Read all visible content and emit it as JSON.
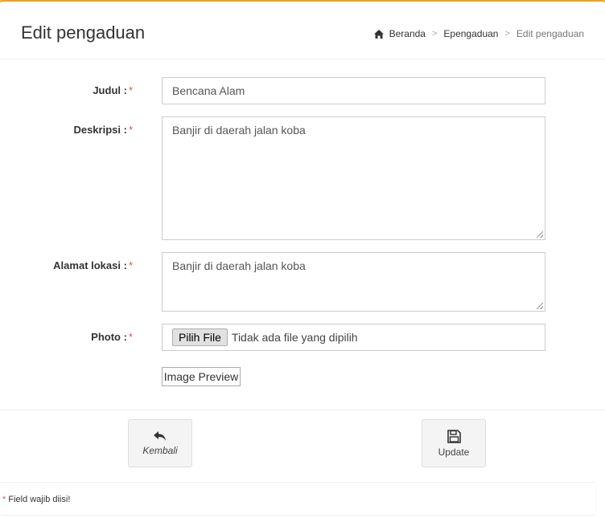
{
  "header": {
    "title": "Edit pengaduan",
    "breadcrumb": [
      {
        "label": "Beranda",
        "icon": "home-icon"
      },
      {
        "label": "Epengaduan"
      },
      {
        "label": "Edit pengaduan"
      }
    ],
    "separator": ">"
  },
  "form": {
    "judul": {
      "label": "Judul :",
      "required_mark": "*",
      "value": "Bencana Alam"
    },
    "deskripsi": {
      "label": "Deskripsi :",
      "required_mark": "*",
      "value": "Banjir di daerah jalan koba"
    },
    "alamat": {
      "label": "Alamat lokasi :",
      "required_mark": "*",
      "value": "Banjir di daerah jalan koba"
    },
    "photo": {
      "label": "Photo :",
      "required_mark": "*",
      "button_label": "Pilih File",
      "status": "Tidak ada file yang dipilih"
    },
    "preview_label": "Image Preview"
  },
  "actions": {
    "back_label": "Kembali",
    "update_label": "Update"
  },
  "note": {
    "mark": "*",
    "text": "Field wajib diisi!"
  },
  "colors": {
    "accent": "#f0c419",
    "required": "#d9534f"
  }
}
